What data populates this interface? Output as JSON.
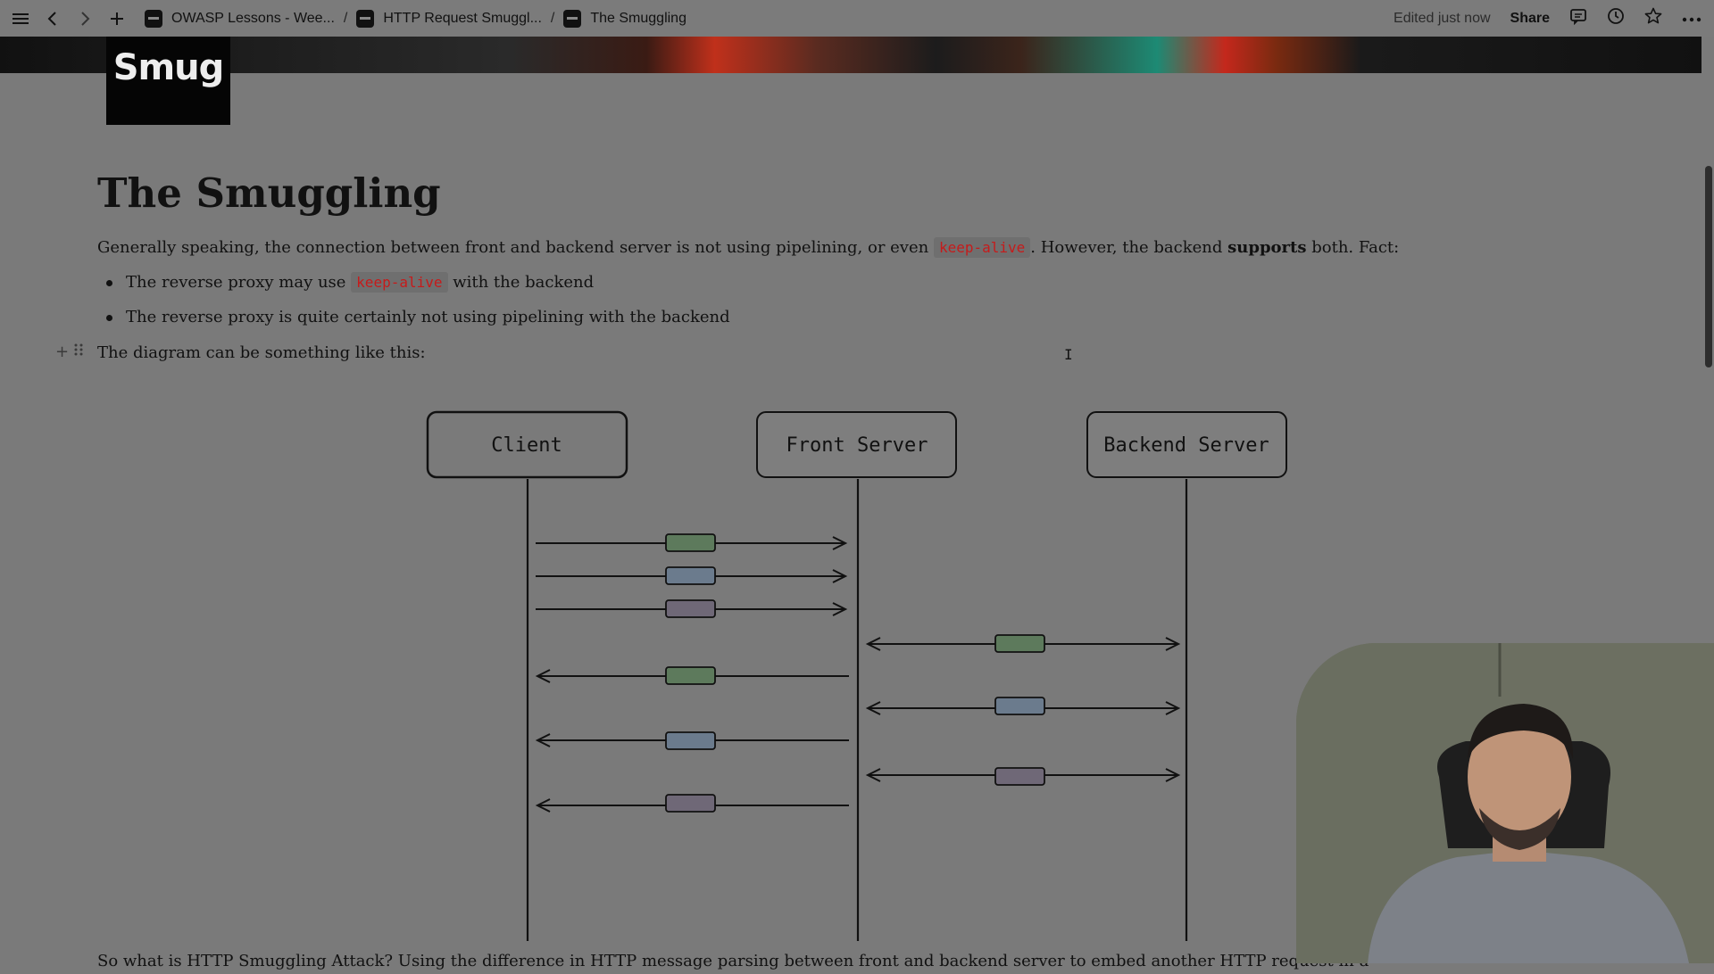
{
  "topbar": {
    "breadcrumbs": [
      {
        "label": "OWASP Lessons - Wee..."
      },
      {
        "label": "HTTP Request Smuggl..."
      },
      {
        "label": "The Smuggling"
      }
    ],
    "separator": "/",
    "edited": "Edited just now",
    "share": "Share"
  },
  "page": {
    "logo_text": "Smug",
    "title": "The Smuggling",
    "intro": {
      "part1": "Generally speaking, the connection between front and backend server is not using pipelining, or even ",
      "code": "keep-alive",
      "part2": ". However, the backend ",
      "bold": "supports",
      "part3": " both. Fact:"
    },
    "bullets": [
      {
        "part1": "The reverse proxy may use ",
        "code": "keep-alive",
        "part2": " with the backend"
      },
      {
        "text": "The reverse proxy is quite certainly not using pipelining with the backend"
      }
    ],
    "diagram_intro": "The diagram can be something like this:",
    "diagram": {
      "nodes": [
        "Client",
        "Front Server",
        "Backend Server"
      ],
      "colors": {
        "green": "#5d7a5c",
        "blue": "#6b7b8d",
        "purple": "#6f6877"
      }
    },
    "bottom_text": "So what is HTTP Smuggling Attack? Using the difference in HTTP message parsing between front and backend server to embed another HTTP request in a normal HTTP requ"
  }
}
